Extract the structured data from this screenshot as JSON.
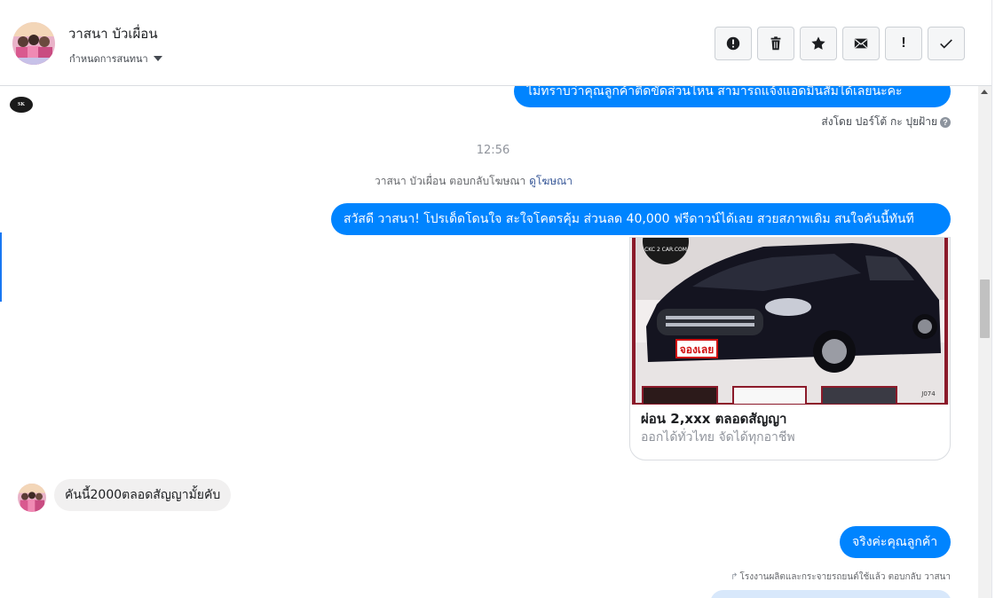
{
  "header": {
    "contact_name": "วาสนา บัวเผื่อน",
    "set_conversation": "กำหนดการสนทนา",
    "actions": [
      {
        "name": "report",
        "icon": "exclamation-circle-icon"
      },
      {
        "name": "delete",
        "icon": "trash-icon"
      },
      {
        "name": "star",
        "icon": "star-icon"
      },
      {
        "name": "mark-unread",
        "icon": "envelope-icon"
      },
      {
        "name": "important",
        "icon": "exclamation-icon",
        "glyph": "!"
      },
      {
        "name": "done",
        "icon": "check-icon"
      }
    ]
  },
  "thread": {
    "page_logo_text": "SK",
    "msg_top": "ไม่ทราบว่าคุณลูกค้าติดขัดส่วนไหน สามารถแจ้งแอดมินสัมได้เลยนะคะ",
    "sent_by": "ส่งโดย ปอร์โต้ กะ ปุยฝ้าย",
    "help_glyph": "?",
    "time": "12:56",
    "ad_reply_text": "วาสนา บัวเผื่อน ตอบกลับโฆษณา",
    "ad_reply_link": "ดูโฆษณา",
    "msg_promo": "สวัสดี วาสนา! โปรเด็ดโดนใจ สะใจโคตรคุ้ม ส่วนลด 40,000 ฟรีดาวน์ได้เลย สวยสภาพเดิม สนใจคันนี้ทันที",
    "card": {
      "logo_text": "CKC 2 CAR.COM",
      "badge_text": "จองเลย",
      "plate_text": "J074",
      "title": "ผ่อน 2,xxx ตลอดสัญญา",
      "subtitle": "ออกได้ทั่วไทย จัดได้ทุกอาชีพ"
    },
    "msg_incoming": "คันนี้2000ตลอดสัญญามั้ยคับ",
    "msg_reply": "จริงค่ะคุณลูกค้า",
    "reply_arrow": "↱",
    "quote_line": "โรงงานผลิตและกระจายรถยนต์ใช้แล้ว ตอบกลับ วาสนา"
  },
  "colors": {
    "outgoing_bubble": "#0084ff",
    "incoming_bubble": "#f1f0f0",
    "link": "#385898"
  }
}
